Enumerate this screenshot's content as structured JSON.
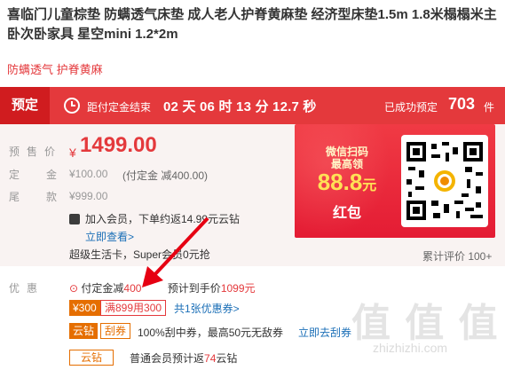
{
  "product": {
    "title": "喜临门儿童棕垫 防螨透气床垫 成人老人护脊黄麻垫 经济型床垫1.5m 1.8米榻榻米主卧次卧家具 星空mini 1.2*2m",
    "subtitle": "防螨透气 护脊黄麻"
  },
  "presale": {
    "tag": "预定",
    "countdown_label": "距付定金结束",
    "countdown": "02 天 06 时 13 分 12.7 秒",
    "booked_label": "已成功预定",
    "booked_count": "703",
    "booked_unit": "件"
  },
  "pricing": {
    "presale_price_label": "预售价",
    "currency": "¥",
    "presale_price": "1499.00",
    "deposit_label": "定金",
    "deposit_value": "¥100.00",
    "deposit_note": "(付定金 减400.00)",
    "balance_label": "尾款",
    "balance_value": "¥999.00"
  },
  "membership": {
    "join_text": "加入会员，下单约返14.99元云钻",
    "view_now": "立即查看>",
    "super_card": "超级生活卡，Super会员0元抢"
  },
  "promo_card": {
    "line1": "微信扫码",
    "line2": "最高领",
    "amount": "88.8",
    "amount_unit": "元",
    "line3": "红包"
  },
  "rating": {
    "text": "累计评价 100+"
  },
  "discounts": {
    "label": "优惠",
    "deposit_prefix": "付定金减",
    "deposit_amount": "400",
    "expected_text": "预计到手价",
    "expected_price": "1099元",
    "coupon_value": "¥300",
    "coupon_condition": "满899用300",
    "coupon_more": "共1张优惠券>",
    "yun_label": "云钻",
    "guaquan_label": "刮券",
    "guaquan_text": "100%刮中券，最高50元无敌券",
    "guaquan_link": "立即去刮券",
    "yunzuan_label": "云钻",
    "yunzuan_text": "普通会员预计返",
    "yunzuan_amount": "74",
    "yunzuan_unit": "云钻"
  },
  "watermark": {
    "text": "值 值 值",
    "site": "zhizhizhi.com"
  }
}
